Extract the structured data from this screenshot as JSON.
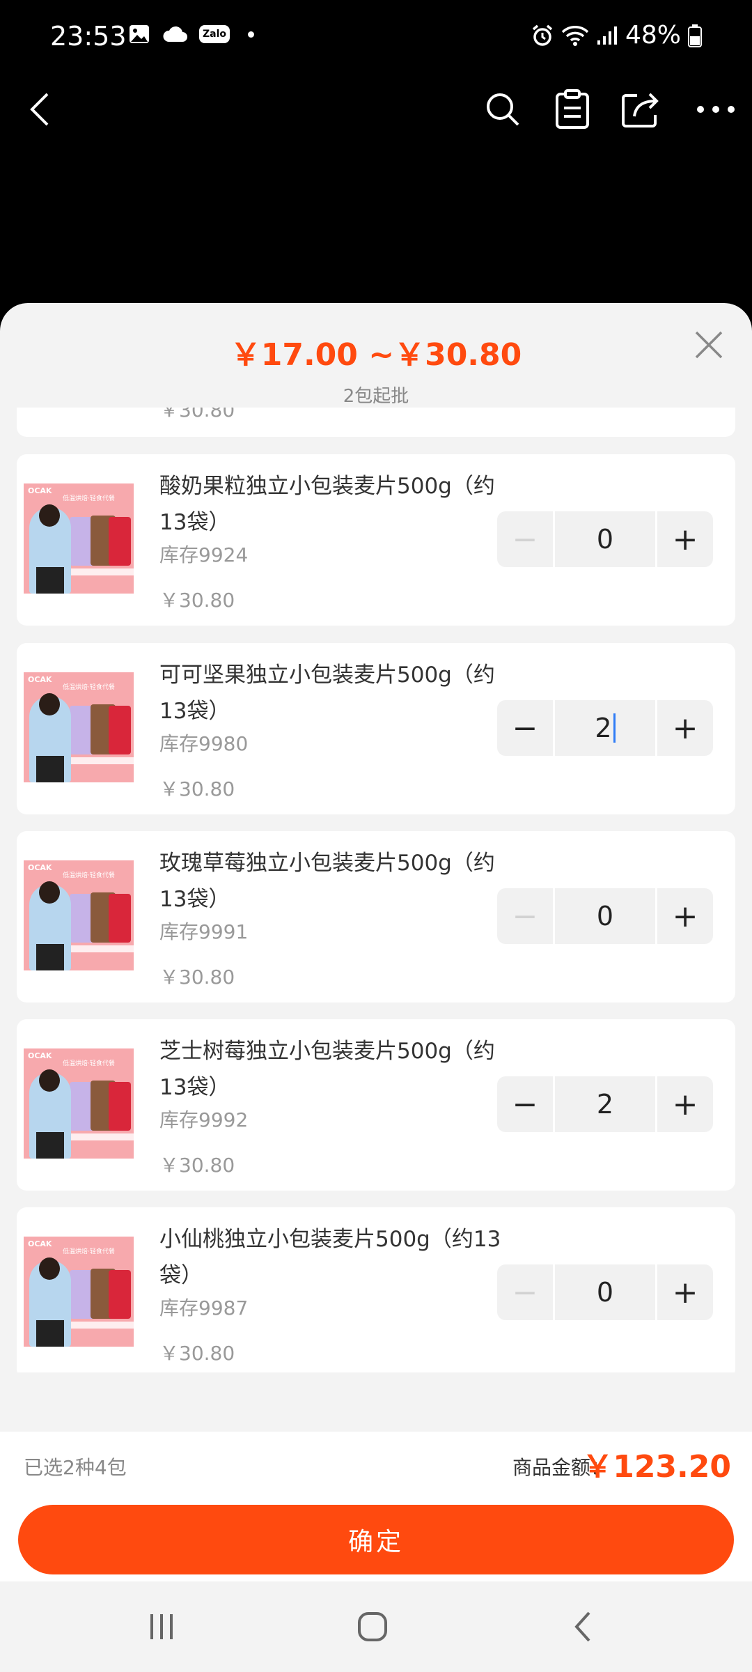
{
  "status_bar": {
    "time": "23:53",
    "zalo": "Zalo",
    "battery": "48%",
    "icons": [
      "gallery-icon",
      "cloud-icon",
      "zalo-icon",
      "alarm-icon",
      "wifi-icon",
      "signal-icon",
      "battery-icon"
    ]
  },
  "top_nav": {
    "icons": [
      "back-icon",
      "search-icon",
      "clipboard-icon",
      "share-icon",
      "more-icon"
    ]
  },
  "sheet": {
    "price_range": "￥17.00 ~￥30.80",
    "moq": "2包起批",
    "partial_item_price": "￥30.80",
    "items": [
      {
        "title": "酸奶果粒独立小包装麦片500g（约13袋）",
        "stock": "库存9924",
        "price": "￥30.80",
        "qty": "0",
        "minus_enabled": false
      },
      {
        "title": "可可坚果独立小包装麦片500g（约13袋）",
        "stock": "库存9980",
        "price": "￥30.80",
        "qty": "2",
        "minus_enabled": true,
        "editing": true
      },
      {
        "title": "玫瑰草莓独立小包装麦片500g（约13袋）",
        "stock": "库存9991",
        "price": "￥30.80",
        "qty": "0",
        "minus_enabled": false
      },
      {
        "title": "芝士树莓独立小包装麦片500g（约13袋）",
        "stock": "库存9992",
        "price": "￥30.80",
        "qty": "2",
        "minus_enabled": true
      },
      {
        "title": "小仙桃独立小包装麦片500g（约13袋）",
        "stock": "库存9987",
        "price": "￥30.80",
        "qty": "0",
        "minus_enabled": false
      }
    ],
    "product_image": {
      "logo": "OCAK",
      "tagline": "低温烘焙·轻食代餐"
    }
  },
  "footer": {
    "selected": "已选2种4包",
    "total_label": "商品金额：",
    "total_value": "￥123.20",
    "confirm": "确定"
  },
  "colors": {
    "accent": "#ff4a0f",
    "sheet_bg": "#f3f3f3"
  }
}
